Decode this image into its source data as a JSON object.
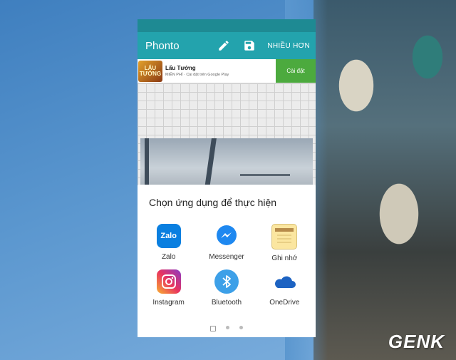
{
  "app": {
    "title": "Phonto",
    "more_label": "NHIỀU HƠN",
    "icons": [
      "pencil-icon",
      "save-icon"
    ]
  },
  "ad": {
    "logo_text": "LẨU TƯỚNG",
    "name": "Lẩu Tướng",
    "subtitle": "MIỄN PHÍ · Cài đặt trên Google Play",
    "install_label": "Cài đặt"
  },
  "share_sheet": {
    "title": "Chọn ứng dụng để thực hiện",
    "apps": [
      {
        "label": "Zalo",
        "icon": "zalo-icon"
      },
      {
        "label": "Messenger",
        "icon": "messenger-icon"
      },
      {
        "label": "Ghi nhớ",
        "icon": "memo-icon"
      },
      {
        "label": "Instagram",
        "icon": "instagram-icon"
      },
      {
        "label": "Bluetooth",
        "icon": "bluetooth-icon"
      },
      {
        "label": "OneDrive",
        "icon": "onedrive-icon"
      }
    ],
    "pages": 3,
    "active_page": 1
  },
  "watermark": "GENK",
  "colors": {
    "status_bar": "#1e8a93",
    "app_bar": "#23a3ad",
    "install_button": "#4caa3e"
  }
}
